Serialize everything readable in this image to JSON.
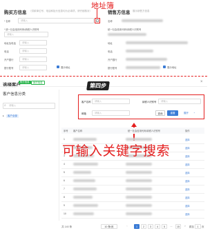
{
  "buyer": {
    "title": "购买方信息",
    "hint": "（供款单位号、电话和抬头信息均为必填项，请仔细核对）",
    "name_label": "* 名称",
    "name_placeholder": "请输入",
    "tax_label": "* 统一社会信用代码/纳税人识别号",
    "tax_placeholder": "请输入",
    "addr_label": "地址及电话",
    "addr_placeholder": "请输入",
    "phone_label": "电话",
    "phone_placeholder": "请输入",
    "bank_label": "开户银行",
    "bank_placeholder": "请输入",
    "account_label": "银行账号",
    "account_placeholder": "请输入",
    "show_label": "展示地址"
  },
  "seller": {
    "title": "销售方信息",
    "hint": "展示销售方信息",
    "name_label": "名称",
    "tax_label": "统一社会信用代码/纳税人识别号",
    "addr_label": "地址",
    "phone_label": "电话",
    "bank_label": "开户银行",
    "account_label": "银行账号",
    "show_label": "展示地址"
  },
  "annotations": {
    "address_book": "地址簿",
    "step4": "第四步",
    "keyword_search": "可输入关键字搜索"
  },
  "dialog": {
    "title": "选择客户",
    "tag1": "购方信息",
    "tag2": "销方信息",
    "category_title": "客户信息分类",
    "tree_placeholder": "请输入",
    "tree_item": "客户全部"
  },
  "search": {
    "customer_name_label": "客户名称",
    "customer_name_placeholder": "请输入",
    "tax_id_label": "纳税人识别号",
    "tax_id_placeholder": "请输入",
    "email_label": "邮箱",
    "email_placeholder": "请输入",
    "query_button": "查询",
    "reset_button": "重置",
    "expand_label": "展开"
  },
  "table": {
    "headers": [
      "序号",
      "客户名称",
      "统一社会信用代码/纳税人识别号",
      "操作"
    ],
    "indices": [
      "1",
      "2",
      "3",
      "4",
      "5",
      "6",
      "7",
      "8",
      "9",
      "10"
    ],
    "action": "选择"
  },
  "pagination": {
    "total": "共 140 条",
    "page_size": "10 条/页",
    "pages": [
      "1",
      "2",
      "3",
      "4",
      "5",
      "...",
      "15"
    ],
    "jump_prefix": "跳至",
    "jump_value": "1",
    "jump_suffix": "页"
  },
  "colors": {
    "accent": "#3a7bd5",
    "annotation_red": "#e41e1e",
    "step_green": "#27b34a",
    "page_active": "#3a7bd5"
  }
}
